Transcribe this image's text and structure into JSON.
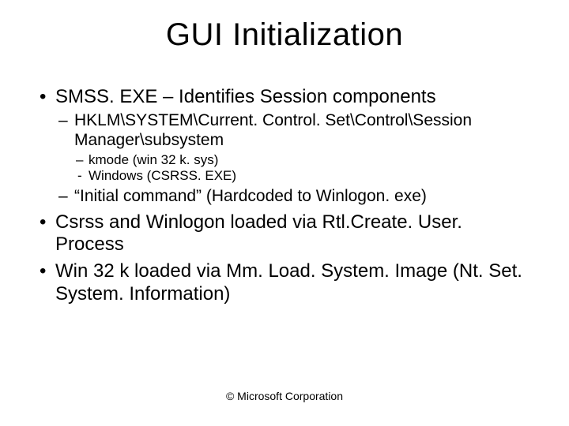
{
  "title": "GUI Initialization",
  "bullets": {
    "b1": "SMSS. EXE – Identifies Session components",
    "b1_1": "HKLM\\SYSTEM\\Current. Control. Set\\Control\\Session Manager\\subsystem",
    "b1_1_a": "kmode (win 32 k. sys)",
    "b1_1_b": "Windows (CSRSS. EXE)",
    "b1_2": "“Initial command” (Hardcoded to Winlogon. exe)",
    "b2": "Csrss and Winlogon loaded via Rtl.Create. User. Process",
    "b3": "Win 32 k loaded via Mm. Load. System. Image (Nt. Set. System. Information)"
  },
  "footer": "© Microsoft Corporation"
}
